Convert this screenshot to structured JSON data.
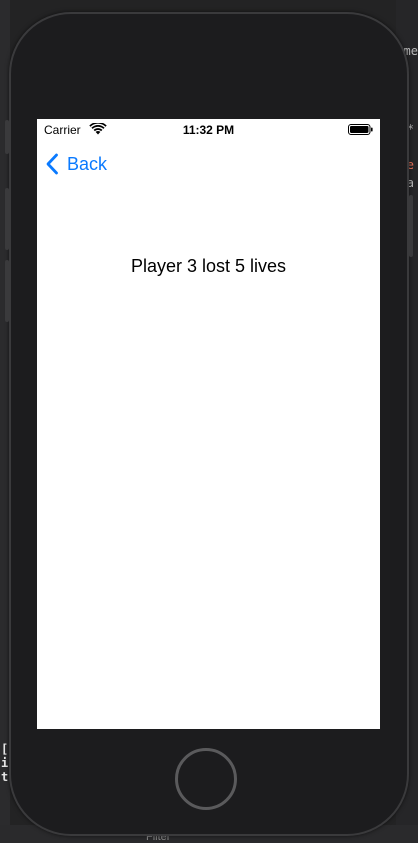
{
  "ide": {
    "right_fragments": [
      "me",
      "*",
      "e",
      "a"
    ],
    "left_fragments": [
      "[",
      "i",
      "t"
    ],
    "filter_label": "Filter"
  },
  "status_bar": {
    "carrier": "Carrier",
    "time": "11:32 PM",
    "icons": [
      "wifi-icon",
      "battery-icon"
    ]
  },
  "nav": {
    "back_label": "Back",
    "accent": "#0a7aff"
  },
  "content": {
    "message": "Player 3 lost 5 lives"
  }
}
